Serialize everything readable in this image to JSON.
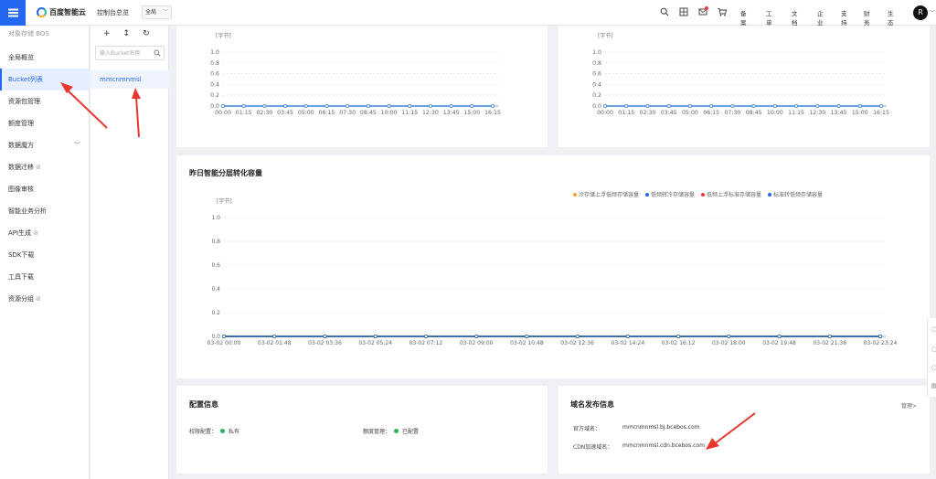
{
  "topbar": {
    "brand": "百度智能云",
    "console": "控制台总览",
    "region": "全局",
    "links": [
      "备案",
      "工单",
      "文档",
      "企业",
      "支持",
      "财务",
      "生态"
    ],
    "avatar": "R",
    "icons": [
      "search-icon",
      "grid-icon",
      "message-icon",
      "cart-icon"
    ]
  },
  "leftnav": {
    "header": "对象存储 BOS",
    "items": [
      {
        "label": "全局概览"
      },
      {
        "label": "Bucket列表"
      },
      {
        "label": "资源包管理"
      },
      {
        "label": "额度管理"
      },
      {
        "label": "数据魔方"
      },
      {
        "label": "数据迁移"
      },
      {
        "label": "图像审核"
      },
      {
        "label": "智能业务分析"
      },
      {
        "label": "API生成"
      },
      {
        "label": "SDK下载"
      },
      {
        "label": "工具下载"
      },
      {
        "label": "资源分组"
      }
    ]
  },
  "buckets": {
    "search_placeholder": "输入Bucket名称",
    "items": [
      "mmcnmnmsl"
    ]
  },
  "top_charts": {
    "unit": "[字节]",
    "y_ticks": [
      "1.0",
      "0.8",
      "0.6",
      "0.4",
      "0.2",
      "0.0"
    ],
    "x_ticks": [
      "00:00",
      "01:15",
      "02:30",
      "03:45",
      "05:00",
      "06:15",
      "07:30",
      "08:45",
      "10:00",
      "11:15",
      "12:30",
      "13:45",
      "15:00",
      "16:15"
    ]
  },
  "tier_chart": {
    "title": "昨日智能分层转化容量",
    "unit": "[字节]",
    "y_ticks": [
      "1.0",
      "0.8",
      "0.6",
      "0.4",
      "0.2",
      "0.0"
    ],
    "x_ticks": [
      "03-02 00:00",
      "03-02 01:48",
      "03-02 03:36",
      "03-02 05:24",
      "03-02 07:12",
      "03-02 09:00",
      "03-02 10:48",
      "03-02 12:36",
      "03-02 14:24",
      "03-02 16:12",
      "03-02 18:00",
      "03-02 19:48",
      "03-02 21:36",
      "03-02 23:24"
    ],
    "legend": [
      {
        "label": "冷存储上浮低频存储容量",
        "color": "#f5a623"
      },
      {
        "label": "低频转冷存储容量",
        "color": "#2468f2"
      },
      {
        "label": "低频上浮标准存储容量",
        "color": "#f33"
      },
      {
        "label": "标准转低频存储容量",
        "color": "#2468f2"
      }
    ]
  },
  "chart_data": [
    {
      "type": "line",
      "ylabel": "[字节]",
      "ylim": [
        0,
        1.0
      ],
      "x": [
        "00:00",
        "01:15",
        "02:30",
        "03:45",
        "05:00",
        "06:15",
        "07:30",
        "08:45",
        "10:00",
        "11:15",
        "12:30",
        "13:45",
        "15:00",
        "16:15"
      ],
      "series": [
        {
          "values": [
            0,
            0,
            0,
            0,
            0,
            0,
            0,
            0,
            0,
            0,
            0,
            0,
            0,
            0
          ]
        }
      ],
      "grid": true
    },
    {
      "type": "line",
      "ylabel": "[字节]",
      "ylim": [
        0,
        1.0
      ],
      "x": [
        "00:00",
        "01:15",
        "02:30",
        "03:45",
        "05:00",
        "06:15",
        "07:30",
        "08:45",
        "10:00",
        "11:15",
        "12:30",
        "13:45",
        "15:00",
        "16:15"
      ],
      "series": [
        {
          "values": [
            0,
            0,
            0,
            0,
            0,
            0,
            0,
            0,
            0,
            0,
            0,
            0,
            0,
            0
          ]
        }
      ],
      "grid": true
    },
    {
      "type": "line",
      "title": "昨日智能分层转化容量",
      "ylabel": "[字节]",
      "ylim": [
        0,
        1.0
      ],
      "x": [
        "03-02 00:00",
        "03-02 01:48",
        "03-02 03:36",
        "03-02 05:24",
        "03-02 07:12",
        "03-02 09:00",
        "03-02 10:48",
        "03-02 12:36",
        "03-02 14:24",
        "03-02 16:12",
        "03-02 18:00",
        "03-02 19:48",
        "03-02 21:36",
        "03-02 23:24"
      ],
      "series": [
        {
          "name": "冷存储上浮低频存储容量",
          "values": [
            0,
            0,
            0,
            0,
            0,
            0,
            0,
            0,
            0,
            0,
            0,
            0,
            0,
            0
          ]
        },
        {
          "name": "低频转冷存储容量",
          "values": [
            0,
            0,
            0,
            0,
            0,
            0,
            0,
            0,
            0,
            0,
            0,
            0,
            0,
            0
          ]
        },
        {
          "name": "低频上浮标准存储容量",
          "values": [
            0,
            0,
            0,
            0,
            0,
            0,
            0,
            0,
            0,
            0,
            0,
            0,
            0,
            0
          ]
        },
        {
          "name": "标准转低频存储容量",
          "values": [
            0,
            0,
            0,
            0,
            0,
            0,
            0,
            0,
            0,
            0,
            0,
            0,
            0,
            0
          ]
        }
      ],
      "legend": "top-right",
      "grid": true
    }
  ],
  "config": {
    "title": "配置信息",
    "permission_label": "权限配置：",
    "permission_value": "私有",
    "quota_label": "额度管理：",
    "quota_value": "已配置"
  },
  "domain": {
    "title": "域名发布信息",
    "manage": "管理>",
    "official_label": "官方域名：",
    "official_value": "mmcnmnmsl.bj.bcebos.com",
    "cdn_label": "CDN加速域名：",
    "cdn_value": "mmcnmnmsl.cdn.bcebos.com"
  },
  "colors": {
    "accent": "#2468f2",
    "annotation": "#e8372c",
    "ok": "#2fb35c"
  }
}
